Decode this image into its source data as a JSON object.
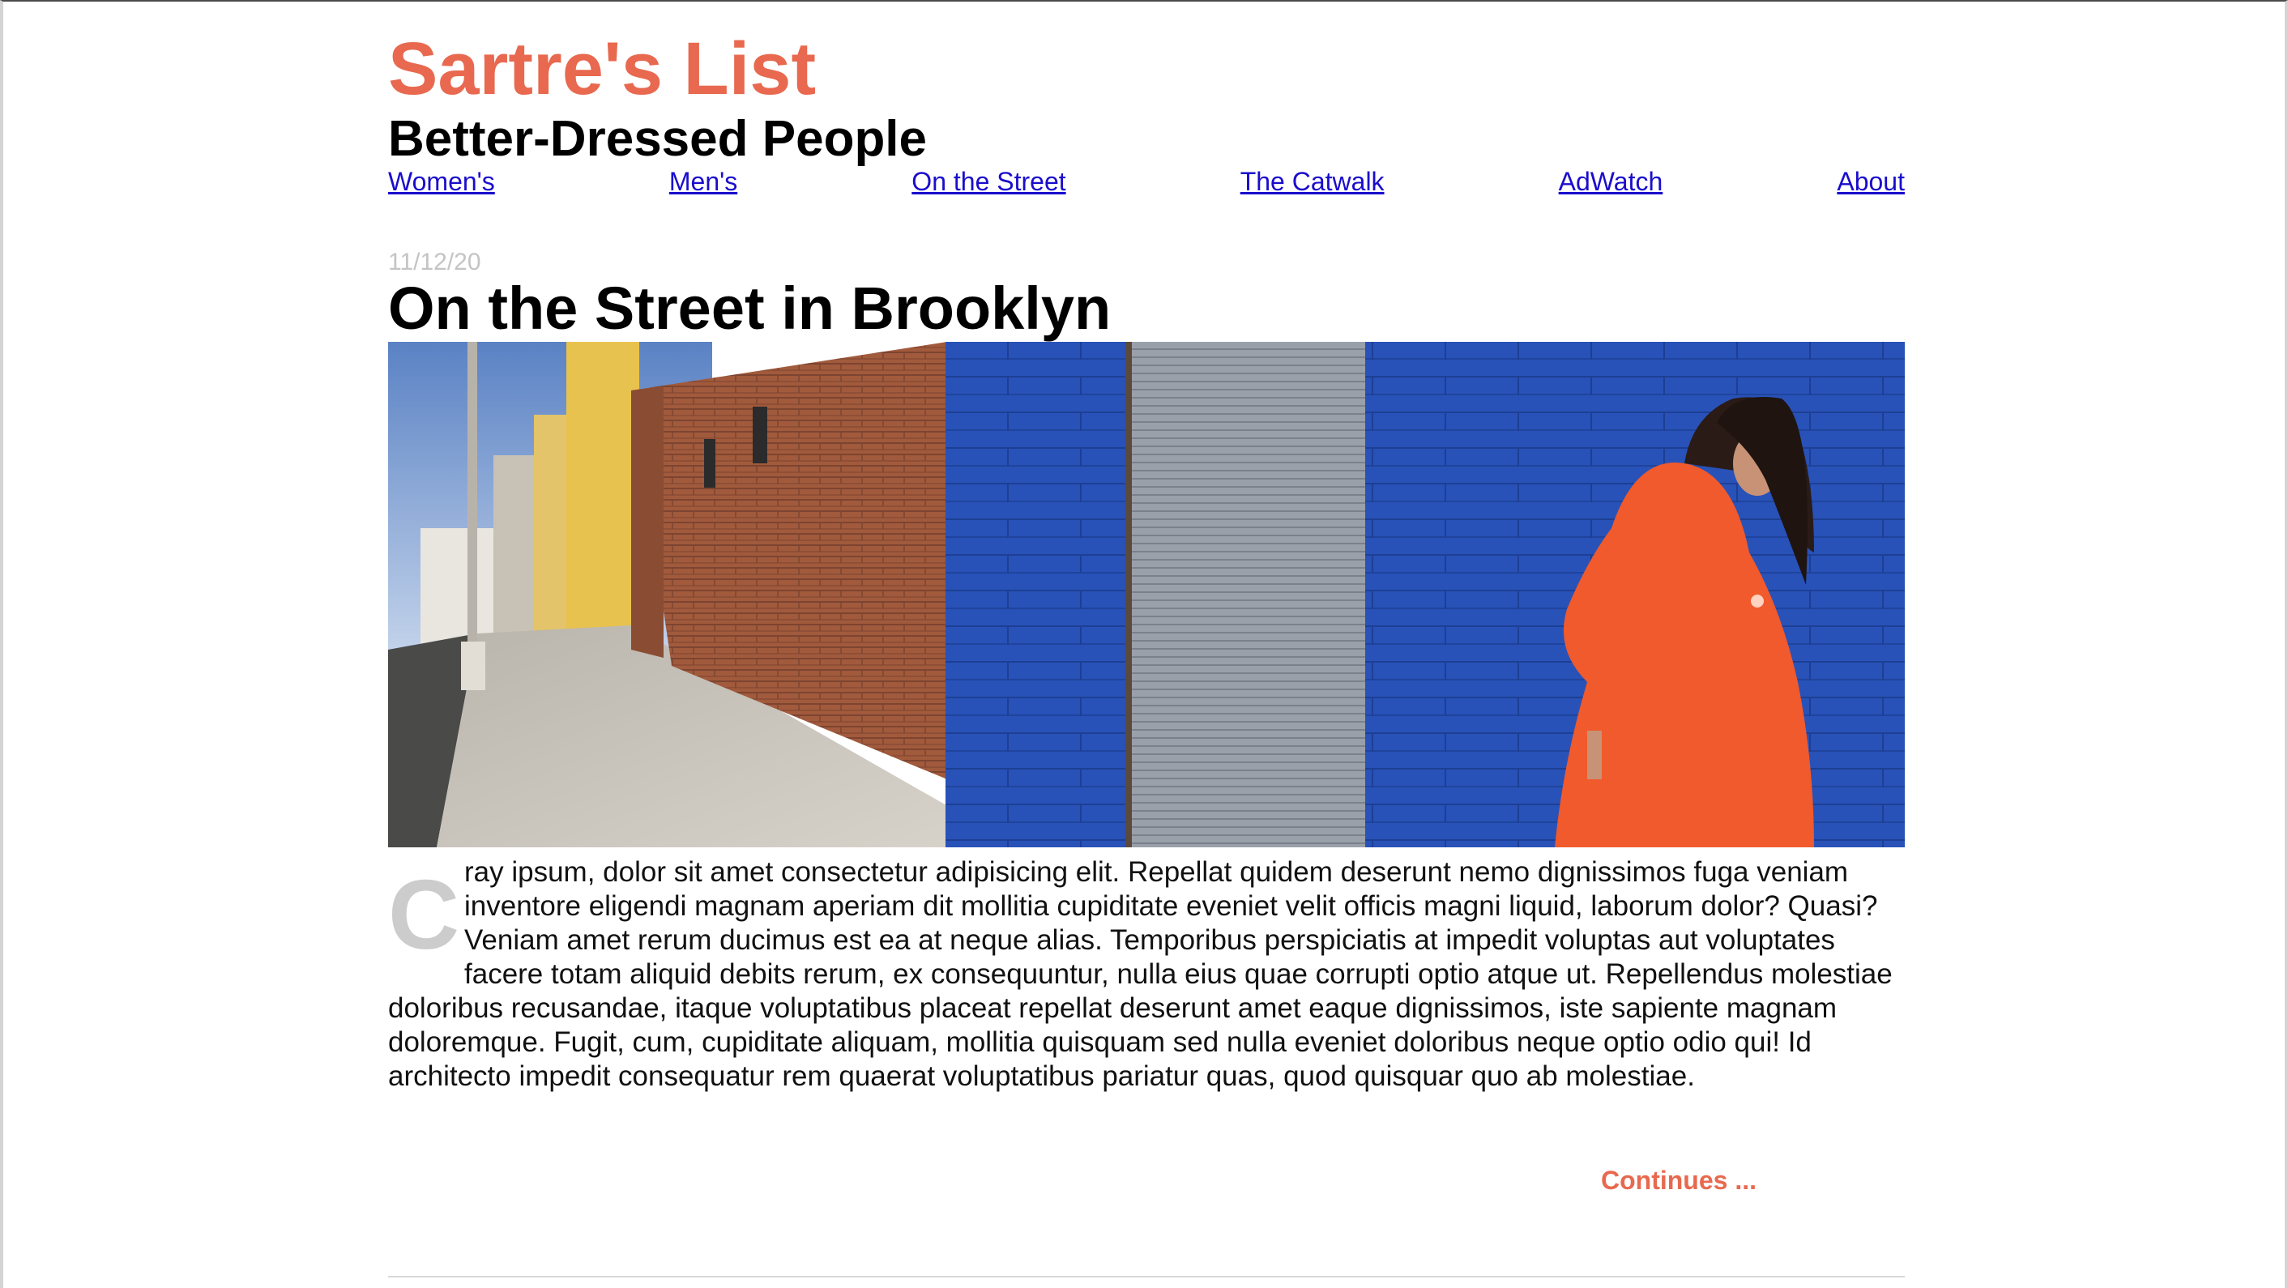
{
  "site": {
    "title": "Sartre's List",
    "subtitle": "Better-Dressed People",
    "accent_color": "#e8694f"
  },
  "nav": {
    "items": [
      {
        "label": "Women's"
      },
      {
        "label": "Men's"
      },
      {
        "label": "On the Street"
      },
      {
        "label": "The Catwalk"
      },
      {
        "label": "AdWatch"
      },
      {
        "label": "About"
      }
    ],
    "link_color": "#1a0dcc"
  },
  "post": {
    "date": "11/12/20",
    "title": "On the Street in Brooklyn",
    "image_description_icon": "street-photo",
    "dropcap": "C",
    "body_rest": "ray ipsum, dolor sit amet consectetur adipisicing elit. Repellat quidem deserunt nemo dignissimos fuga veniam inventore eligendi magnam aperiam dit mollitia cupiditate eveniet velit officis magni liquid, laborum dolor? Quasi? Veniam amet rerum ducimus est ea at neque alias. Temporibus perspiciatis at impedit voluptas aut voluptates facere totam aliquid debits rerum, ex consequuntur, nulla eius quae corrupti optio atque ut. Repellendus molestiae doloribus recusandae, itaque voluptatibus placeat repellat deserunt amet eaque dignissimos, iste sapiente magnam doloremque. Fugit, cum, cupiditate aliquam, mollitia quisquam sed nulla eveniet doloribus neque optio odio qui! Id architecto impedit consequatur rem quaerat voluptatibus pariatur quas, quod quisquar quo ab molestiae.",
    "continue_label": "Continues ..."
  }
}
